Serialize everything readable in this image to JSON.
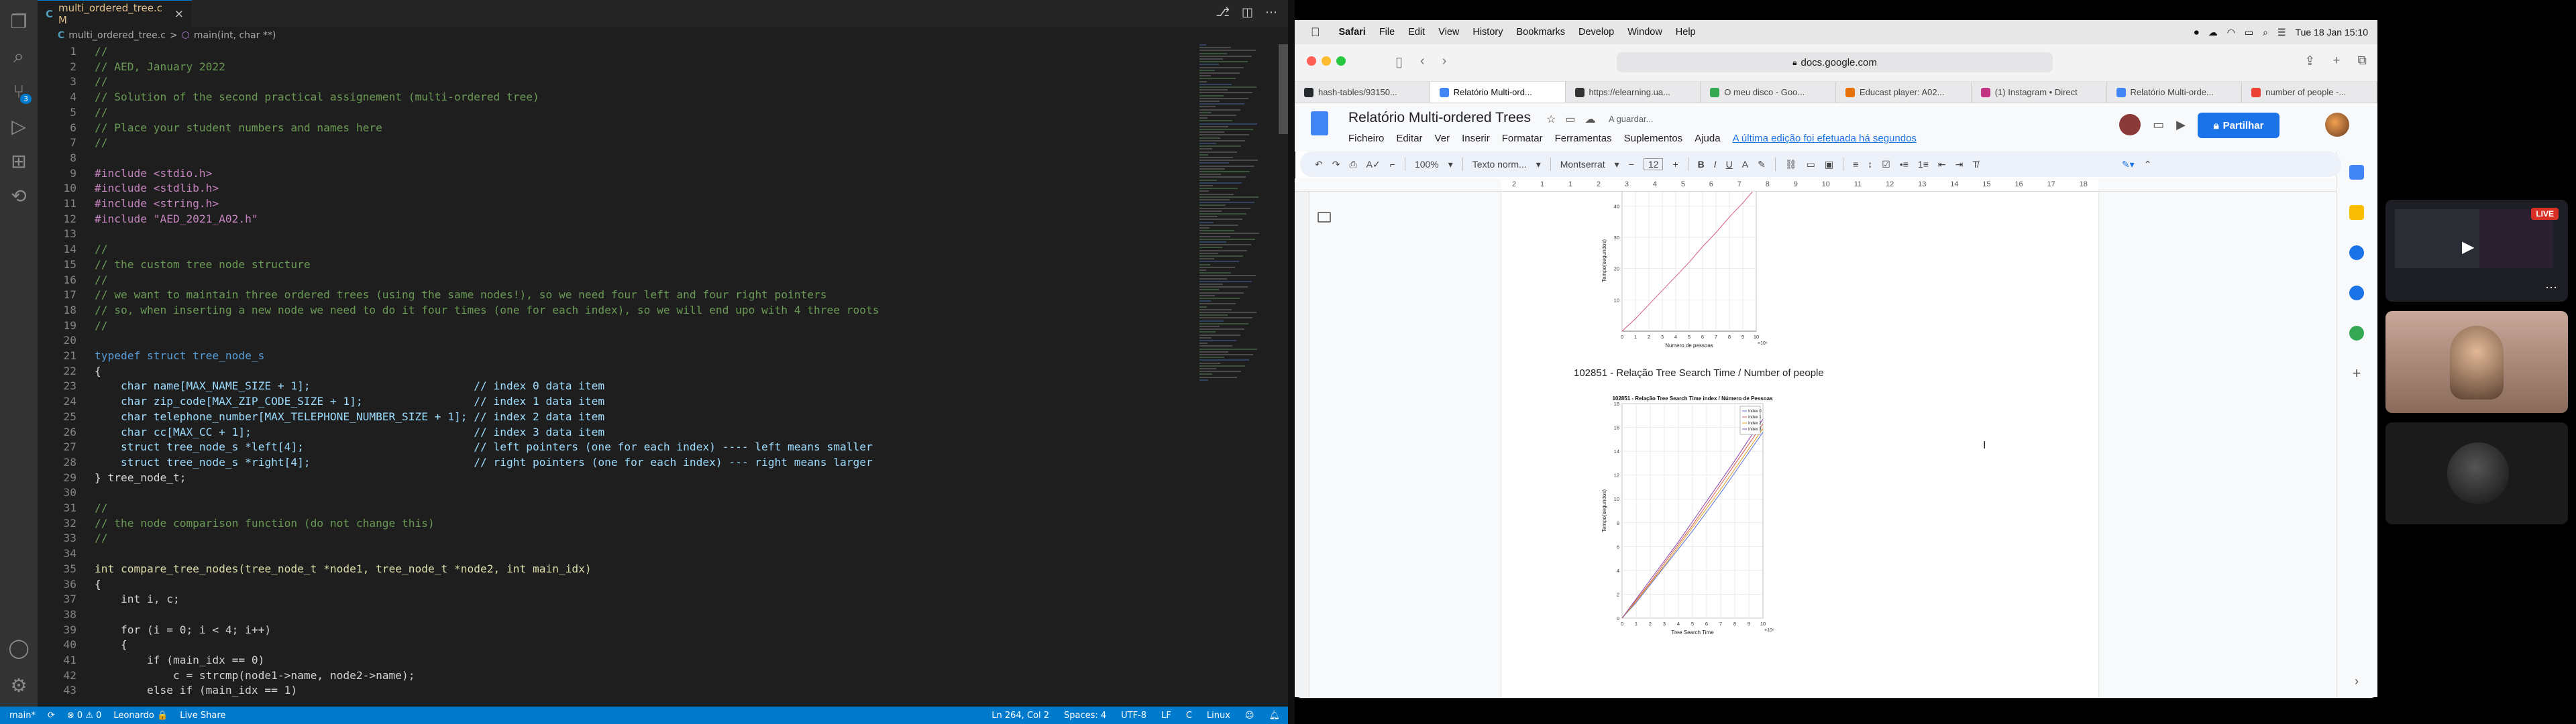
{
  "vscode": {
    "tab": {
      "icon": "C",
      "label": "multi_ordered_tree.c M",
      "close": "×"
    },
    "tab_actions": [
      "branch-icon",
      "split-icon",
      "more-icon"
    ],
    "breadcrumb": {
      "icon": "C",
      "file": "multi_ordered_tree.c",
      "sep": ">",
      "symbol_icon": "⬡",
      "symbol": "main(int, char **)"
    },
    "activity": [
      "files-icon",
      "search-icon",
      "source-control-icon",
      "run-icon",
      "extensions-icon",
      "remote-icon",
      "account-icon",
      "settings-icon"
    ],
    "scm_badge": "3",
    "lines": [
      {
        "n": "1",
        "t": "//",
        "c": "cm"
      },
      {
        "n": "2",
        "t": "// AED, January 2022",
        "c": "cm"
      },
      {
        "n": "3",
        "t": "//",
        "c": "cm"
      },
      {
        "n": "4",
        "t": "// Solution of the second practical assignement (multi-ordered tree)",
        "c": "cm"
      },
      {
        "n": "5",
        "t": "//",
        "c": "cm"
      },
      {
        "n": "6",
        "t": "// Place your student numbers and names here",
        "c": "cm"
      },
      {
        "n": "7",
        "t": "//",
        "c": "cm"
      },
      {
        "n": "8",
        "t": "",
        "c": "pl"
      },
      {
        "n": "9",
        "t": "#include <stdio.h>",
        "c": "pp"
      },
      {
        "n": "10",
        "t": "#include <stdlib.h>",
        "c": "pp"
      },
      {
        "n": "11",
        "t": "#include <string.h>",
        "c": "pp"
      },
      {
        "n": "12",
        "t": "#include \"AED_2021_A02.h\"",
        "c": "pp"
      },
      {
        "n": "13",
        "t": "",
        "c": "pl"
      },
      {
        "n": "14",
        "t": "//",
        "c": "cm"
      },
      {
        "n": "15",
        "t": "// the custom tree node structure",
        "c": "cm"
      },
      {
        "n": "16",
        "t": "//",
        "c": "cm"
      },
      {
        "n": "17",
        "t": "// we want to maintain three ordered trees (using the same nodes!), so we need four left and four right pointers",
        "c": "cm"
      },
      {
        "n": "18",
        "t": "// so, when inserting a new node we need to do it four times (one for each index), so we will end upo with 4 three roots",
        "c": "cm"
      },
      {
        "n": "19",
        "t": "//",
        "c": "cm"
      },
      {
        "n": "20",
        "t": "",
        "c": "pl"
      },
      {
        "n": "21",
        "t": "typedef struct tree_node_s",
        "c": "kw"
      },
      {
        "n": "22",
        "t": "{",
        "c": "pl"
      },
      {
        "n": "23",
        "t": "    char name[MAX_NAME_SIZE + 1];                         // index 0 data item",
        "c": "mx"
      },
      {
        "n": "24",
        "t": "    char zip_code[MAX_ZIP_CODE_SIZE + 1];                 // index 1 data item",
        "c": "mx"
      },
      {
        "n": "25",
        "t": "    char telephone_number[MAX_TELEPHONE_NUMBER_SIZE + 1]; // index 2 data item",
        "c": "mx"
      },
      {
        "n": "26",
        "t": "    char cc[MAX_CC + 1];                                  // index 3 data item",
        "c": "mx"
      },
      {
        "n": "27",
        "t": "    struct tree_node_s *left[4];                          // left pointers (one for each index) ---- left means smaller",
        "c": "mx"
      },
      {
        "n": "28",
        "t": "    struct tree_node_s *right[4];                         // right pointers (one for each index) --- right means larger",
        "c": "mx"
      },
      {
        "n": "29",
        "t": "} tree_node_t;",
        "c": "pl"
      },
      {
        "n": "30",
        "t": "",
        "c": "pl"
      },
      {
        "n": "31",
        "t": "//",
        "c": "cm"
      },
      {
        "n": "32",
        "t": "// the node comparison function (do not change this)",
        "c": "cm"
      },
      {
        "n": "33",
        "t": "//",
        "c": "cm"
      },
      {
        "n": "34",
        "t": "",
        "c": "pl"
      },
      {
        "n": "35",
        "t": "int compare_tree_nodes(tree_node_t *node1, tree_node_t *node2, int main_idx)",
        "c": "fn"
      },
      {
        "n": "36",
        "t": "{",
        "c": "pl"
      },
      {
        "n": "37",
        "t": "    int i, c;",
        "c": "pl"
      },
      {
        "n": "38",
        "t": "",
        "c": "pl"
      },
      {
        "n": "39",
        "t": "    for (i = 0; i < 4; i++)",
        "c": "pl"
      },
      {
        "n": "40",
        "t": "    {",
        "c": "pl"
      },
      {
        "n": "41",
        "t": "        if (main_idx == 0)",
        "c": "pl"
      },
      {
        "n": "42",
        "t": "            c = strcmp(node1->name, node2->name);",
        "c": "pl"
      },
      {
        "n": "43",
        "t": "        else if (main_idx == 1)",
        "c": "pl"
      }
    ],
    "status": {
      "branch": "main*",
      "sync": "⟳",
      "problems": "⊗ 0 ⚠ 0",
      "user": "Leonardo 🔒",
      "live_share": "Live Share",
      "cursor": "Ln 264, Col 2",
      "spaces": "Spaces: 4",
      "encoding": "UTF-8",
      "eol": "LF",
      "lang": "C",
      "os": "Linux"
    }
  },
  "mac_menubar": {
    "apple": "",
    "items": [
      "Safari",
      "File",
      "Edit",
      "View",
      "History",
      "Bookmarks",
      "Develop",
      "Window",
      "Help"
    ],
    "clock": "Tue 18 Jan  15:10"
  },
  "safari": {
    "url": "docs.google.com",
    "tabs": [
      {
        "label": "hash-tables/93150...",
        "color": "#24292e"
      },
      {
        "label": "Relatório Multi-ord...",
        "color": "#4285f4",
        "active": true
      },
      {
        "label": "https://elearning.ua...",
        "color": "#333"
      },
      {
        "label": "O meu disco - Goo...",
        "color": "#34a853"
      },
      {
        "label": "Educast player: A02...",
        "color": "#e8710a"
      },
      {
        "label": "(1) Instagram • Direct",
        "color": "#c13584"
      },
      {
        "label": "Relatório Multi-orde...",
        "color": "#4285f4"
      },
      {
        "label": "number of people -...",
        "color": "#ea4335"
      }
    ]
  },
  "docs": {
    "title": "Relatório Multi-ordered Trees",
    "saving": "A guardar...",
    "menus": [
      "Ficheiro",
      "Editar",
      "Ver",
      "Inserir",
      "Formatar",
      "Ferramentas",
      "Suplementos",
      "Ajuda"
    ],
    "last_edit": "A última edição foi efetuada há segundos",
    "share": "Partilhar",
    "toolbar": {
      "zoom": "100%",
      "style": "Texto norm...",
      "font": "Montserrat",
      "size": "12"
    },
    "ruler": [
      "2",
      "1",
      "1",
      "2",
      "3",
      "4",
      "5",
      "6",
      "7",
      "8",
      "9",
      "10",
      "11",
      "12",
      "13",
      "14",
      "15",
      "16",
      "17",
      "18"
    ],
    "caption": "102851 - Relação Tree Search Time / Number of people"
  },
  "chart_data": [
    {
      "type": "line",
      "title": "",
      "xlabel": "Numero de pessoas",
      "ylabel": "Tempo(segundos)",
      "xlim": [
        0,
        10
      ],
      "ylim": [
        0,
        45
      ],
      "x_ticks": [
        "0",
        "1",
        "2",
        "3",
        "4",
        "5",
        "6",
        "7",
        "8",
        "9",
        "10"
      ],
      "y_ticks": [
        "10",
        "20",
        "30",
        "40"
      ],
      "x_multiplier": "×10⁶",
      "series": [
        {
          "x": [
            0,
            1,
            2,
            3,
            4,
            5,
            6,
            7,
            8,
            9,
            10
          ],
          "values": [
            0,
            4,
            8.5,
            13,
            17.5,
            22,
            27,
            31.5,
            36.5,
            41,
            46
          ]
        }
      ]
    },
    {
      "type": "line",
      "title": "102851 - Relação Tree Search Time index / Número de Pessoas",
      "xlabel": "Tree Search Time",
      "ylabel": "Tempo(segundos)",
      "xlim": [
        0,
        10
      ],
      "ylim": [
        0,
        18
      ],
      "x_ticks": [
        "0",
        "1",
        "2",
        "3",
        "4",
        "5",
        "6",
        "7",
        "8",
        "9",
        "10"
      ],
      "y_ticks": [
        "0",
        "2",
        "4",
        "6",
        "8",
        "10",
        "12",
        "14",
        "16",
        "18"
      ],
      "x_multiplier": "×10⁶",
      "legend": "top-right",
      "series": [
        {
          "name": "Index 0",
          "color": "#5a6fd6",
          "x": [
            0,
            1,
            2,
            3,
            4,
            5,
            6,
            7,
            8,
            9,
            10
          ],
          "values": [
            0,
            1.3,
            2.8,
            4.3,
            5.8,
            7.3,
            8.9,
            10.5,
            12.2,
            13.9,
            15.6
          ]
        },
        {
          "name": "Index 1",
          "color": "#d65a5a",
          "x": [
            0,
            1,
            2,
            3,
            4,
            5,
            6,
            7,
            8,
            9,
            10
          ],
          "values": [
            0,
            1.5,
            3.0,
            4.6,
            6.2,
            7.8,
            9.5,
            11.2,
            12.9,
            14.6,
            16.3
          ]
        },
        {
          "name": "Index 2",
          "color": "#e3a020",
          "x": [
            0,
            1,
            2,
            3,
            4,
            5,
            6,
            7,
            8,
            9,
            10
          ],
          "values": [
            0,
            1.4,
            2.9,
            4.4,
            6.0,
            7.6,
            9.2,
            10.8,
            12.5,
            14.2,
            15.9
          ]
        },
        {
          "name": "Index 3",
          "color": "#8e44ad",
          "x": [
            0,
            1,
            2,
            3,
            4,
            5,
            6,
            7,
            8,
            9,
            10
          ],
          "values": [
            0,
            1.6,
            3.2,
            4.8,
            6.4,
            8.1,
            9.8,
            11.5,
            13.2,
            15.0,
            16.7
          ]
        }
      ]
    }
  ],
  "rail": {
    "live": "LIVE"
  },
  "colors": {
    "comment": "#6a9955",
    "keyword": "#569cd6",
    "preproc": "#c586c0",
    "type": "#4ec9b0",
    "func": "#dcdcaa",
    "string": "#ce9178",
    "accent": "#007acc"
  }
}
